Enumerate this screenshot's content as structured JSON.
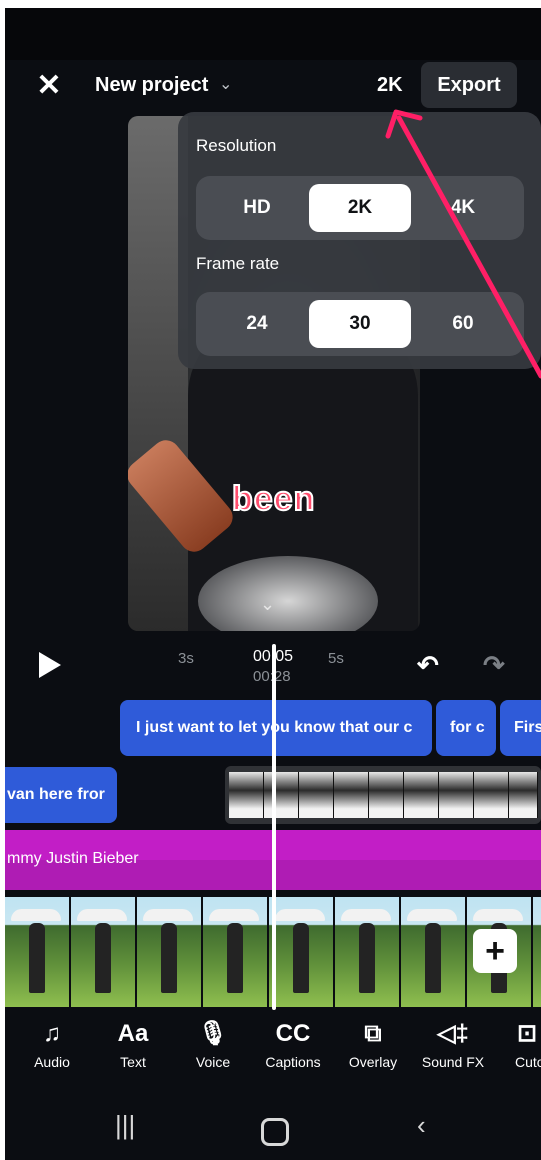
{
  "topbar": {
    "title": "New project",
    "resolution": "2K",
    "export_label": "Export"
  },
  "popup": {
    "resolution_title": "Resolution",
    "resolution_options": [
      "HD",
      "2K",
      "4K"
    ],
    "resolution_selected": "2K",
    "framerate_title": "Frame rate",
    "framerate_options": [
      "24",
      "30",
      "60"
    ],
    "framerate_selected": "30"
  },
  "preview": {
    "caption_word": "been"
  },
  "timeline": {
    "ticks": [
      "3s",
      "5s"
    ],
    "current_time": "00:05",
    "total_time": "00:28",
    "caption_clips": [
      "I just want to let you know that our c",
      "for c",
      "Firs"
    ],
    "text_clip": "van here fror",
    "audio_label": "mmy  Justin Bieber"
  },
  "toolbar": {
    "items": [
      {
        "label": "Audio",
        "icon": "music-note-icon"
      },
      {
        "label": "Text",
        "icon": "text-aa-icon"
      },
      {
        "label": "Voice",
        "icon": "microphone-icon"
      },
      {
        "label": "Captions",
        "icon": "cc-icon"
      },
      {
        "label": "Overlay",
        "icon": "overlay-icon"
      },
      {
        "label": "Sound FX",
        "icon": "sound-fx-icon"
      },
      {
        "label": "Cuto",
        "icon": "cutout-icon"
      }
    ]
  },
  "colors": {
    "accent_blue": "#2f5bd9",
    "audio_magenta": "#c21ec6",
    "arrow_red": "#ff1f66"
  }
}
